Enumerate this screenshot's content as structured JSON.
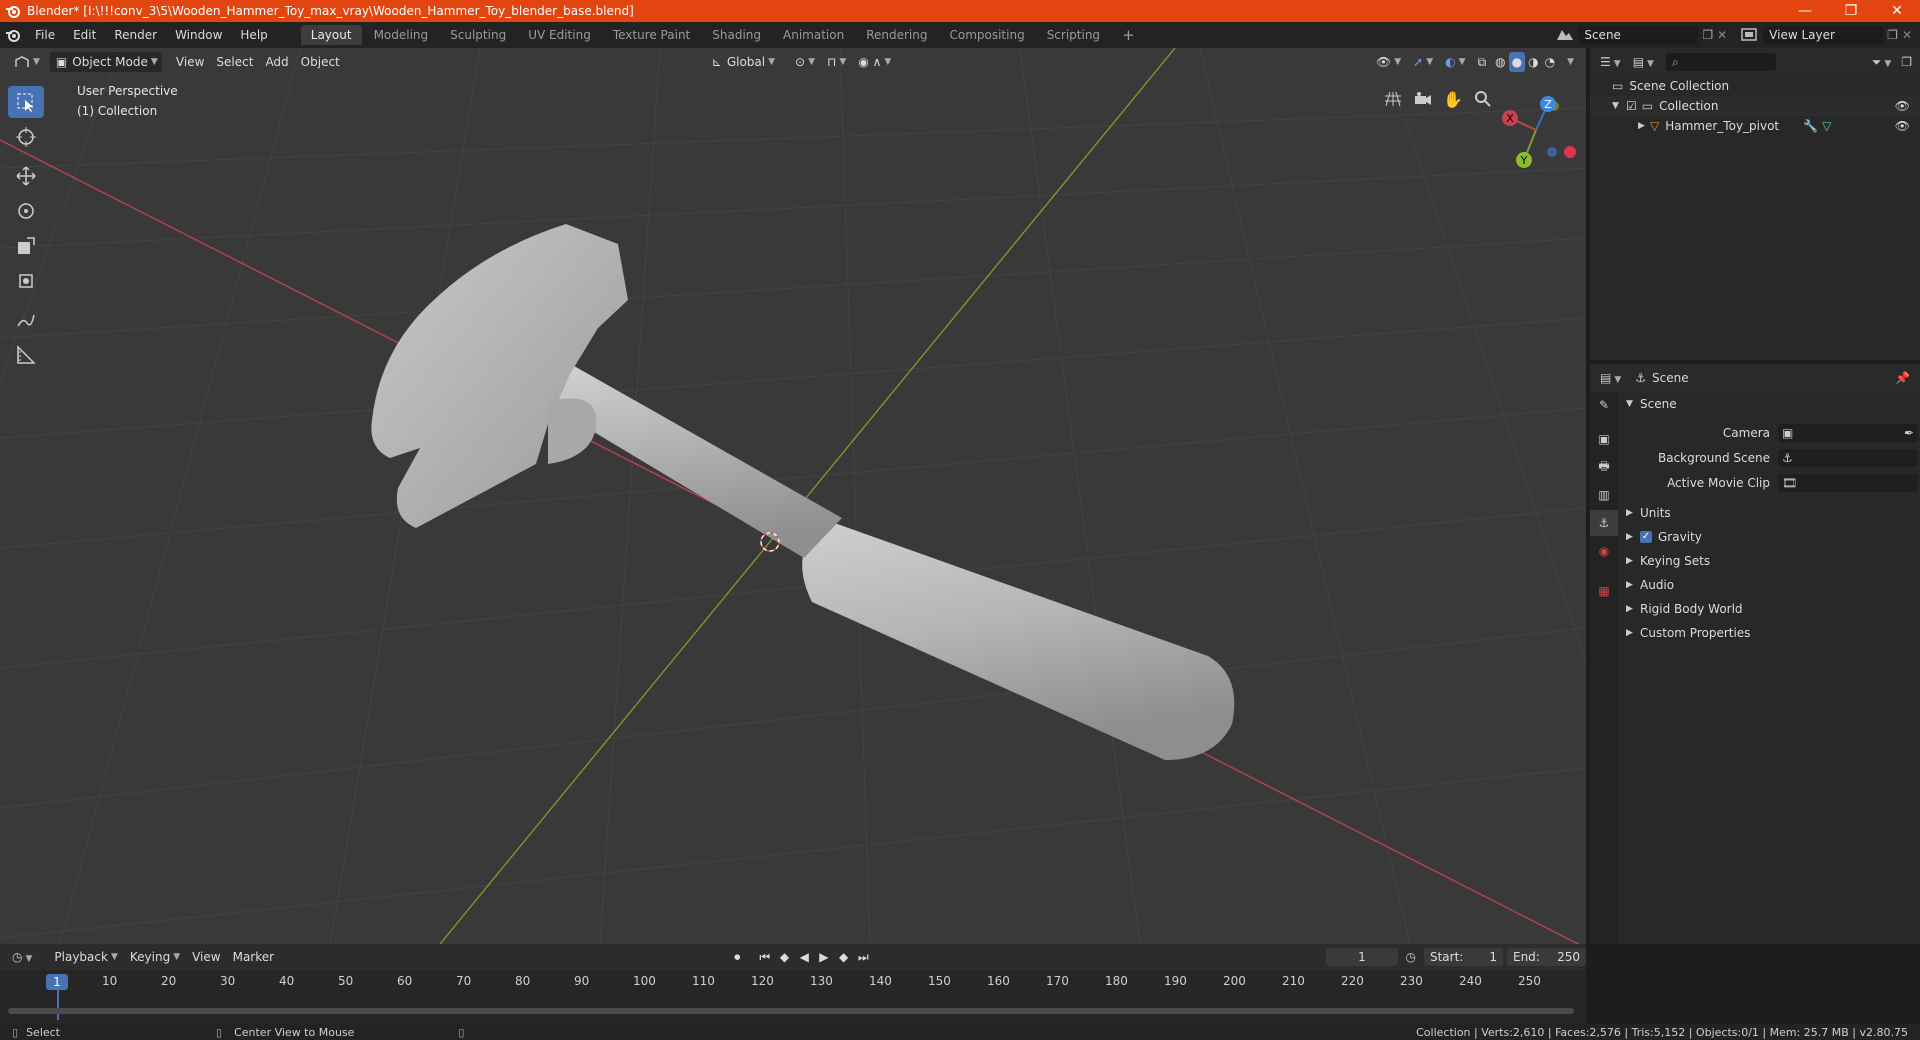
{
  "window": {
    "title": "Blender* [I:\\!!!conv_3\\5\\Wooden_Hammer_Toy_max_vray\\Wooden_Hammer_Toy_blender_base.blend]",
    "minimize": "—",
    "maximize": "❐",
    "close": "✕"
  },
  "menu": [
    "File",
    "Edit",
    "Render",
    "Window",
    "Help"
  ],
  "workspaces": [
    "Layout",
    "Modeling",
    "Sculpting",
    "UV Editing",
    "Texture Paint",
    "Shading",
    "Animation",
    "Rendering",
    "Compositing",
    "Scripting"
  ],
  "workspace_add": "+",
  "scene_selector": {
    "value": "Scene"
  },
  "view_layer_selector": {
    "value": "View Layer"
  },
  "viewport": {
    "mode": "Object Mode",
    "menus": [
      "View",
      "Select",
      "Add",
      "Object"
    ],
    "transform_orientation": "Global",
    "perspective_label": "User Perspective",
    "collection_label": "(1) Collection",
    "gizmo": {
      "x": "X",
      "y": "Y",
      "z": "Z"
    },
    "colors": {
      "background": "#393939",
      "grid": "#444444",
      "x_axis": "#c0434f",
      "y_axis": "#7f9e2a",
      "model": "#b7b7b7"
    }
  },
  "outliner": {
    "scene_collection": "Scene Collection",
    "collection": "Collection",
    "object": "Hammer_Toy_pivot"
  },
  "properties": {
    "header_title": "Scene",
    "panel_title": "Scene",
    "fields": [
      {
        "label": "Camera",
        "value": ""
      },
      {
        "label": "Background Scene",
        "value": ""
      },
      {
        "label": "Active Movie Clip",
        "value": ""
      }
    ],
    "subpanels": [
      "Units",
      "Gravity",
      "Keying Sets",
      "Audio",
      "Rigid Body World",
      "Custom Properties"
    ],
    "gravity_checked": true
  },
  "timeline": {
    "menus": [
      "Playback",
      "Keying",
      "View",
      "Marker"
    ],
    "current_frame": "1",
    "start_label": "Start:",
    "start_value": "1",
    "end_label": "End:",
    "end_value": "250",
    "ruler_current": "1",
    "ruler_ticks": [
      "10",
      "20",
      "30",
      "40",
      "50",
      "60",
      "70",
      "80",
      "90",
      "100",
      "110",
      "120",
      "130",
      "140",
      "150",
      "160",
      "170",
      "180",
      "190",
      "200",
      "210",
      "220",
      "230",
      "240",
      "250"
    ]
  },
  "statusbar": {
    "left_action": "Select",
    "middle_action": "Center View to Mouse",
    "stats": "Collection | Verts:2,610 | Faces:2,576 | Tris:5,152 | Objects:0/1 | Mem: 25.7 MB | v2.80.75"
  },
  "accent_color": "#4772b3",
  "titlebar_color": "#e2450f"
}
